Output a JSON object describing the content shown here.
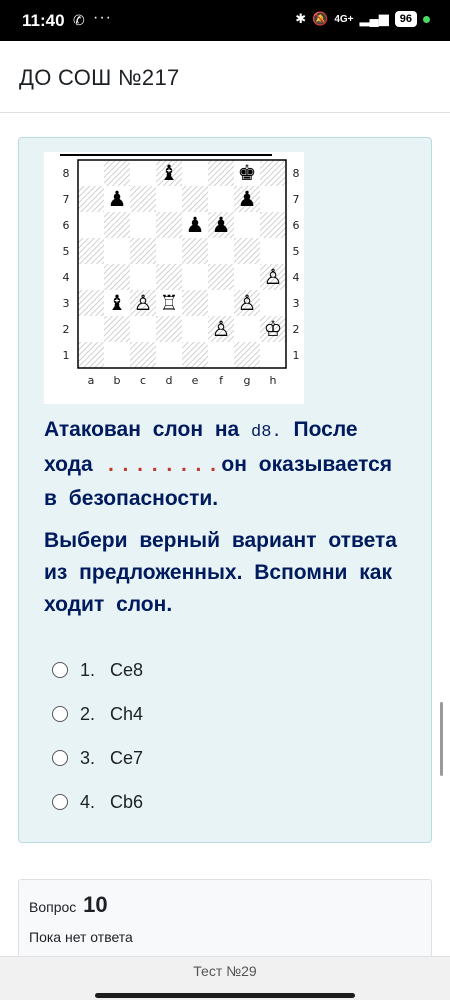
{
  "status_bar": {
    "time": "11:40",
    "dots": "···",
    "network": "4G+",
    "battery": "96"
  },
  "header": {
    "title": "ДО СОШ №217"
  },
  "board": {
    "files": [
      "a",
      "b",
      "c",
      "d",
      "e",
      "f",
      "g",
      "h"
    ],
    "ranks": [
      "8",
      "7",
      "6",
      "5",
      "4",
      "3",
      "2",
      "1"
    ],
    "pieces": [
      {
        "square": "d8",
        "glyph": "♝",
        "color": "black"
      },
      {
        "square": "g8",
        "glyph": "♚",
        "color": "black"
      },
      {
        "square": "b7",
        "glyph": "♟",
        "color": "black"
      },
      {
        "square": "g7",
        "glyph": "♟",
        "color": "black"
      },
      {
        "square": "e6",
        "glyph": "♟",
        "color": "black"
      },
      {
        "square": "f6",
        "glyph": "♟",
        "color": "black"
      },
      {
        "square": "h4",
        "glyph": "♙",
        "color": "white"
      },
      {
        "square": "b3",
        "glyph": "♝",
        "color": "black"
      },
      {
        "square": "c3",
        "glyph": "♙",
        "color": "white"
      },
      {
        "square": "d3",
        "glyph": "♖",
        "color": "white"
      },
      {
        "square": "g3",
        "glyph": "♙",
        "color": "white"
      },
      {
        "square": "f2",
        "glyph": "♙",
        "color": "white"
      },
      {
        "square": "h2",
        "glyph": "♔",
        "color": "white"
      }
    ]
  },
  "question": {
    "line1_a": "Атакован слон на",
    "line1_square": "d8.",
    "line1_b": "После",
    "line2_a": "хода",
    "line2_dots": "........",
    "line2_b": "он оказывается",
    "line3": "в безопасности.",
    "para2": "Выбери верный вариант ответа из предложенных. Вспомни как ходит слон."
  },
  "answers": [
    {
      "num": "1.",
      "text": "Се8"
    },
    {
      "num": "2.",
      "text": "Ch4"
    },
    {
      "num": "3.",
      "text": "Се7"
    },
    {
      "num": "4.",
      "text": "Cb6"
    }
  ],
  "next_question": {
    "label": "Вопрос",
    "number": "10",
    "state": "Пока нет ответа"
  },
  "footer": {
    "title": "Тест №29"
  }
}
